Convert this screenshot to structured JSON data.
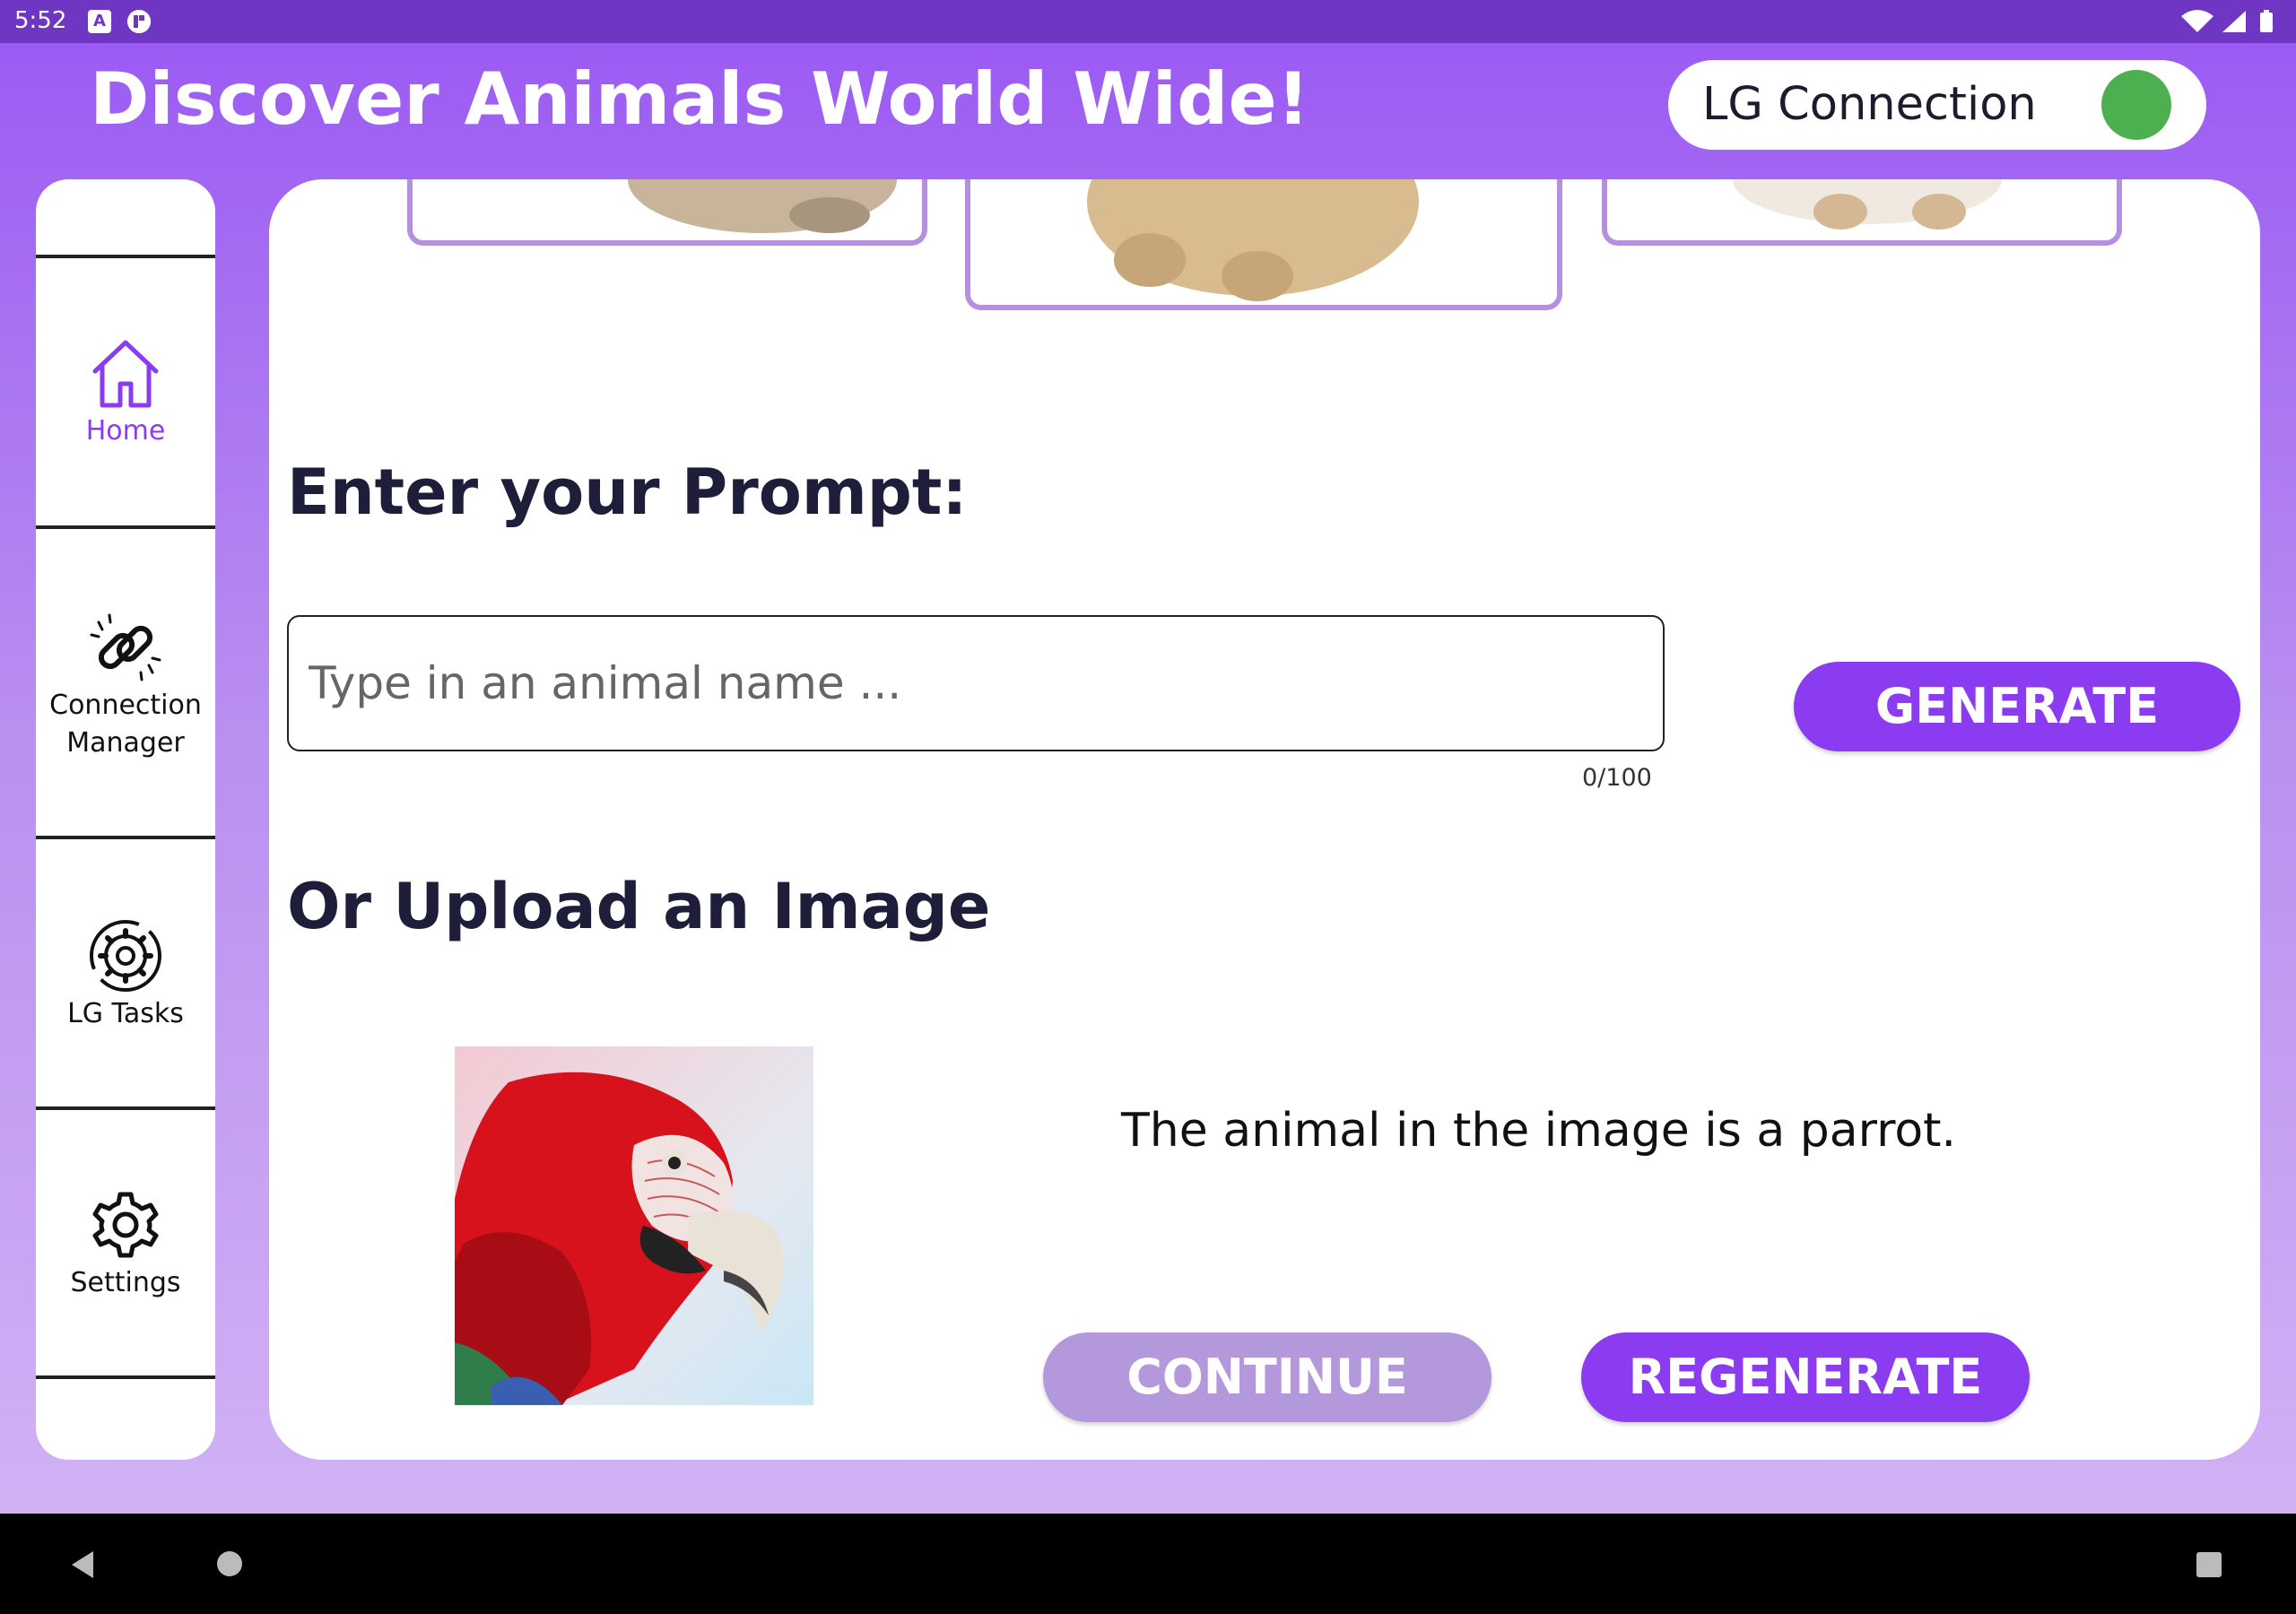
{
  "status_bar": {
    "time": "5:52",
    "notif_icon_1": "A",
    "icons": [
      "a-box-icon",
      "app-notification-icon",
      "wifi-icon",
      "signal-icon",
      "battery-icon"
    ]
  },
  "header": {
    "title": "Discover Animals World Wide!",
    "lg_connection_label": "LG Connection",
    "lg_connection_status_color": "#4caf50"
  },
  "sidebar": {
    "items": [
      {
        "label": "Home",
        "icon": "home-icon",
        "active": true
      },
      {
        "label": "Connection\nManager",
        "label_line1": "Connection",
        "label_line2": "Manager",
        "icon": "link-icon"
      },
      {
        "label": "LG Tasks",
        "icon": "gear-sync-icon"
      },
      {
        "label": "Settings",
        "icon": "gear-icon"
      }
    ]
  },
  "main": {
    "prompt_heading": "Enter your Prompt:",
    "prompt_placeholder": "Type in an animal name ...",
    "prompt_counter": "0/100",
    "generate_label": "GENERATE",
    "upload_heading": "Or Upload an Image",
    "result_text": "The animal in the image is a parrot.",
    "continue_label": "CONTINUE",
    "regenerate_label": "REGENERATE"
  },
  "colors": {
    "accent": "#8c3cf0",
    "accent_muted": "#b498dc",
    "status_bar": "#6e36c2",
    "heading_text": "#1e1e3a"
  },
  "navbar": {
    "icons": [
      "back-icon",
      "home-circle-icon",
      "recents-icon"
    ]
  }
}
